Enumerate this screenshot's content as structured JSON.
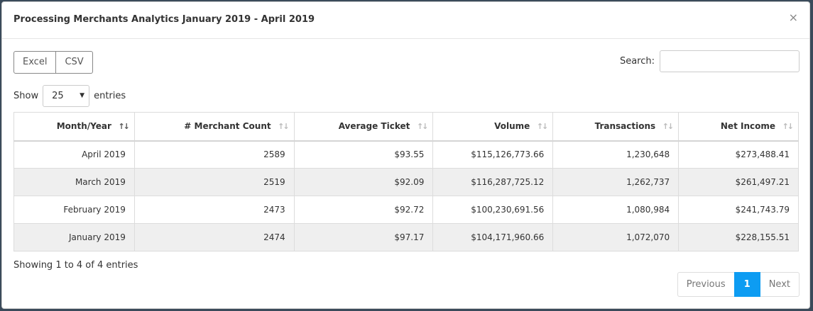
{
  "modal": {
    "title": "Processing Merchants Analytics January 2019 - April 2019",
    "close_icon": "close-icon"
  },
  "export": {
    "excel_label": "Excel",
    "csv_label": "CSV"
  },
  "search": {
    "label": "Search:",
    "value": ""
  },
  "length": {
    "prefix": "Show",
    "selected": "25",
    "suffix": "entries"
  },
  "table": {
    "headers": [
      "Month/Year",
      "# Merchant Count",
      "Average Ticket",
      "Volume",
      "Transactions",
      "Net Income"
    ],
    "rows": [
      [
        "April 2019",
        "2589",
        "$93.55",
        "$115,126,773.66",
        "1,230,648",
        "$273,488.41"
      ],
      [
        "March 2019",
        "2519",
        "$92.09",
        "$116,287,725.12",
        "1,262,737",
        "$261,497.21"
      ],
      [
        "February 2019",
        "2473",
        "$92.72",
        "$100,230,691.56",
        "1,080,984",
        "$241,743.79"
      ],
      [
        "January 2019",
        "2474",
        "$97.17",
        "$104,171,960.66",
        "1,072,070",
        "$228,155.51"
      ]
    ]
  },
  "info": "Showing 1 to 4 of 4 entries",
  "pager": {
    "previous": "Previous",
    "current": "1",
    "next": "Next"
  },
  "colors": {
    "accent": "#0d9cf2",
    "even_row": "#efefef"
  }
}
